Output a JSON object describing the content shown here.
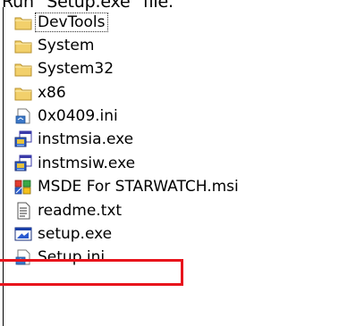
{
  "caption": "Run \"Setup.exe\" file.",
  "files": [
    {
      "name": "DevTools",
      "icon": "folder-icon",
      "selected": true
    },
    {
      "name": "System",
      "icon": "folder-icon"
    },
    {
      "name": "System32",
      "icon": "folder-icon"
    },
    {
      "name": "x86",
      "icon": "folder-icon"
    },
    {
      "name": "0x0409.ini",
      "icon": "ini-file-icon"
    },
    {
      "name": "instmsia.exe",
      "icon": "installer-exe-icon"
    },
    {
      "name": "instmsiw.exe",
      "icon": "installer-exe-icon"
    },
    {
      "name": "MSDE For STARWATCH.msi",
      "icon": "msi-package-icon"
    },
    {
      "name": "readme.txt",
      "icon": "text-file-icon"
    },
    {
      "name": "setup.exe",
      "icon": "setup-exe-icon",
      "highlighted": true
    },
    {
      "name": "Setup.ini",
      "icon": "ini-file-icon"
    }
  ],
  "colors": {
    "highlight": "#e8141c",
    "folder": "#f2d06b"
  }
}
